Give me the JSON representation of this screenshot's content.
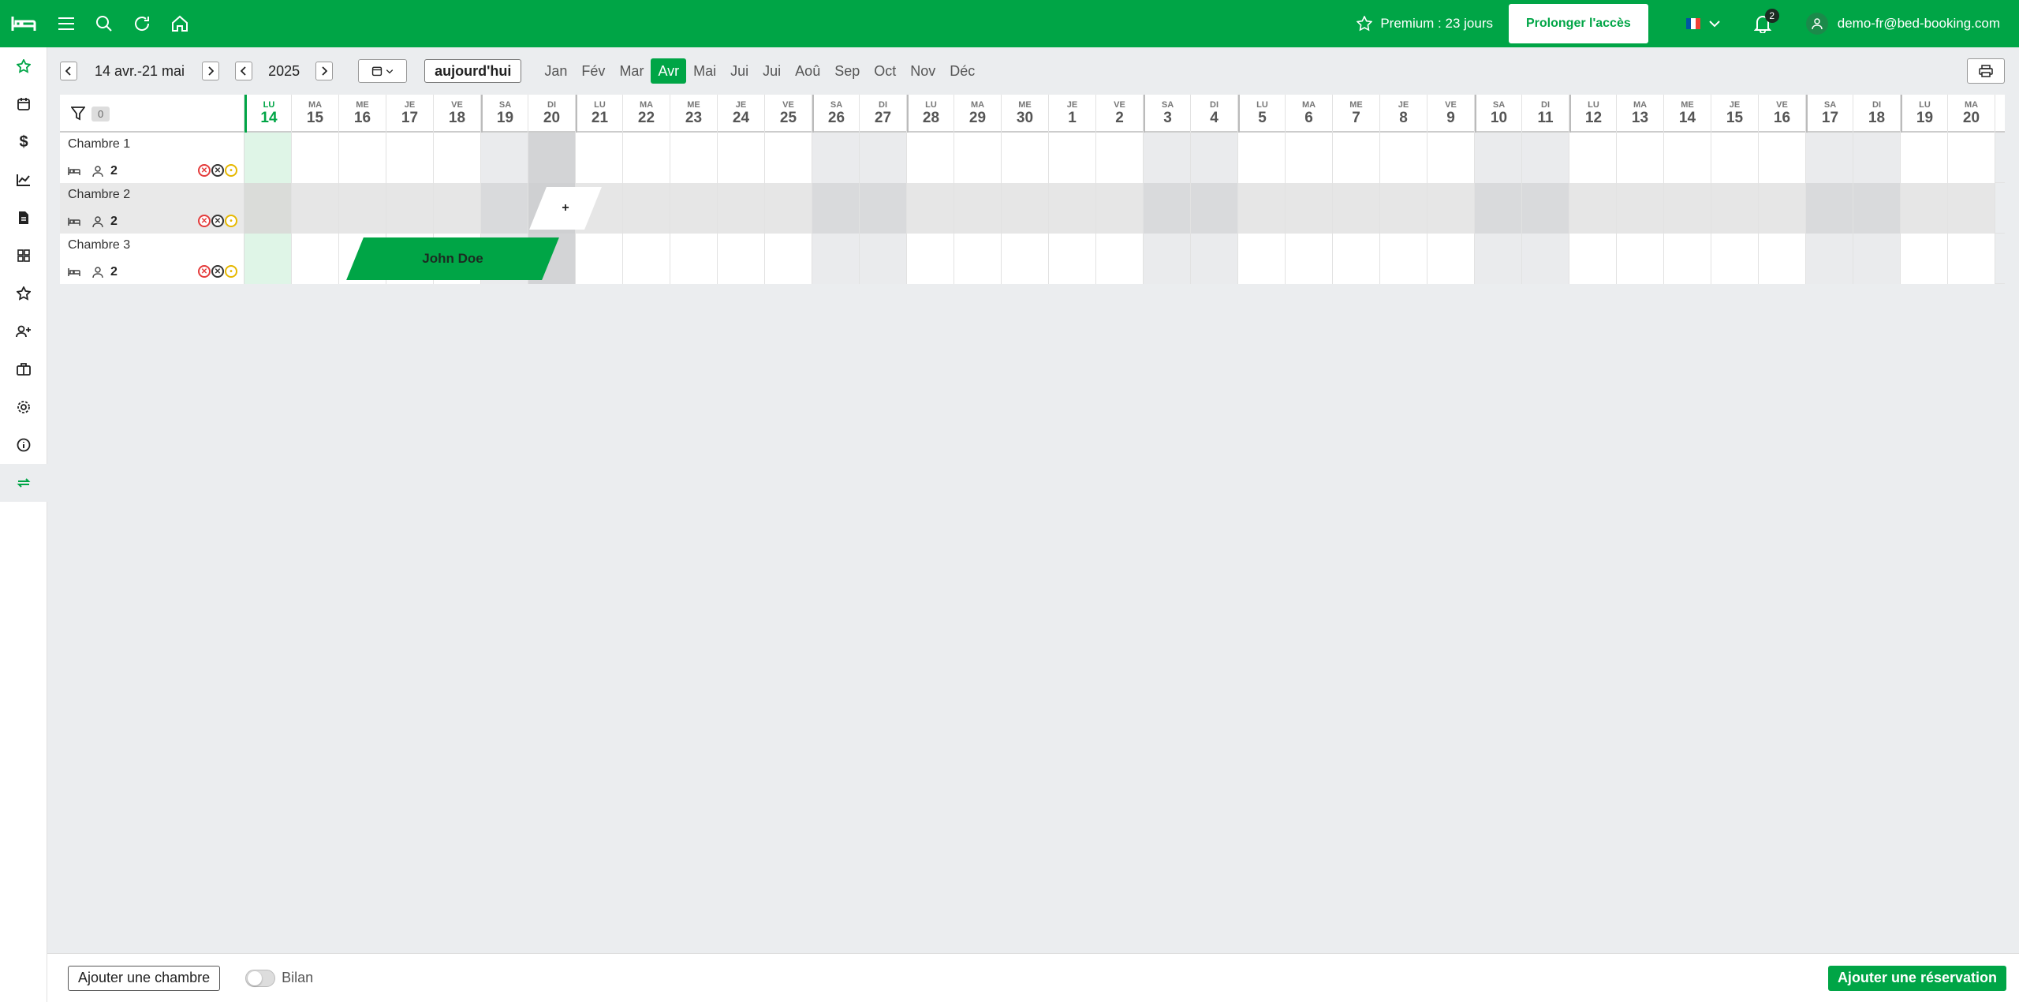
{
  "topbar": {
    "premium_label": "Premium : 23 jours",
    "extend_button": "Prolonger l'accès",
    "notifications_count": "2",
    "user_email": "demo-fr@bed-booking.com",
    "brand_color": "#00a546"
  },
  "sidebar": {
    "items": [
      {
        "icon": "star-icon"
      },
      {
        "icon": "calendar-icon"
      },
      {
        "icon": "dollar-icon"
      },
      {
        "icon": "chart-icon"
      },
      {
        "icon": "document-icon"
      },
      {
        "icon": "grid-icon"
      },
      {
        "icon": "star-outline-icon"
      },
      {
        "icon": "user-add-icon"
      },
      {
        "icon": "briefcase-icon"
      },
      {
        "icon": "gear-icon"
      },
      {
        "icon": "info-icon"
      },
      {
        "icon": "sync-icon"
      }
    ]
  },
  "toolbar": {
    "range": "14 avr.-21 mai",
    "year": "2025",
    "today_button": "aujourd'hui",
    "months": [
      "Jan",
      "Fév",
      "Mar",
      "Avr",
      "Mai",
      "Jui",
      "Jui",
      "Aoû",
      "Sep",
      "Oct",
      "Nov",
      "Déc"
    ],
    "active_month": "Avr"
  },
  "grid": {
    "filter_count": "0",
    "days": [
      {
        "dn": "LU",
        "dd": "14"
      },
      {
        "dn": "MA",
        "dd": "15"
      },
      {
        "dn": "ME",
        "dd": "16"
      },
      {
        "dn": "JE",
        "dd": "17"
      },
      {
        "dn": "VE",
        "dd": "18"
      },
      {
        "dn": "SA",
        "dd": "19"
      },
      {
        "dn": "DI",
        "dd": "20"
      },
      {
        "dn": "LU",
        "dd": "21"
      },
      {
        "dn": "MA",
        "dd": "22"
      },
      {
        "dn": "ME",
        "dd": "23"
      },
      {
        "dn": "JE",
        "dd": "24"
      },
      {
        "dn": "VE",
        "dd": "25"
      },
      {
        "dn": "SA",
        "dd": "26"
      },
      {
        "dn": "DI",
        "dd": "27"
      },
      {
        "dn": "LU",
        "dd": "28"
      },
      {
        "dn": "MA",
        "dd": "29"
      },
      {
        "dn": "ME",
        "dd": "30"
      },
      {
        "dn": "JE",
        "dd": "1"
      },
      {
        "dn": "VE",
        "dd": "2"
      },
      {
        "dn": "SA",
        "dd": "3"
      },
      {
        "dn": "DI",
        "dd": "4"
      },
      {
        "dn": "LU",
        "dd": "5"
      },
      {
        "dn": "MA",
        "dd": "6"
      },
      {
        "dn": "ME",
        "dd": "7"
      },
      {
        "dn": "JE",
        "dd": "8"
      },
      {
        "dn": "VE",
        "dd": "9"
      },
      {
        "dn": "SA",
        "dd": "10"
      },
      {
        "dn": "DI",
        "dd": "11"
      },
      {
        "dn": "LU",
        "dd": "12"
      },
      {
        "dn": "MA",
        "dd": "13"
      },
      {
        "dn": "ME",
        "dd": "14"
      },
      {
        "dn": "JE",
        "dd": "15"
      },
      {
        "dn": "VE",
        "dd": "16"
      },
      {
        "dn": "SA",
        "dd": "17"
      },
      {
        "dn": "DI",
        "dd": "18"
      },
      {
        "dn": "LU",
        "dd": "19"
      },
      {
        "dn": "MA",
        "dd": "20"
      }
    ],
    "rooms": [
      {
        "name": "Chambre 1",
        "capacity": "2"
      },
      {
        "name": "Chambre 2",
        "capacity": "2"
      },
      {
        "name": "Chambre 3",
        "capacity": "2"
      }
    ],
    "booking": {
      "guest": "John Doe"
    },
    "add_slot_label": "+"
  },
  "footer": {
    "add_room_button": "Ajouter une chambre",
    "summary_toggle_label": "Bilan",
    "add_booking_button": "Ajouter une réservation"
  }
}
